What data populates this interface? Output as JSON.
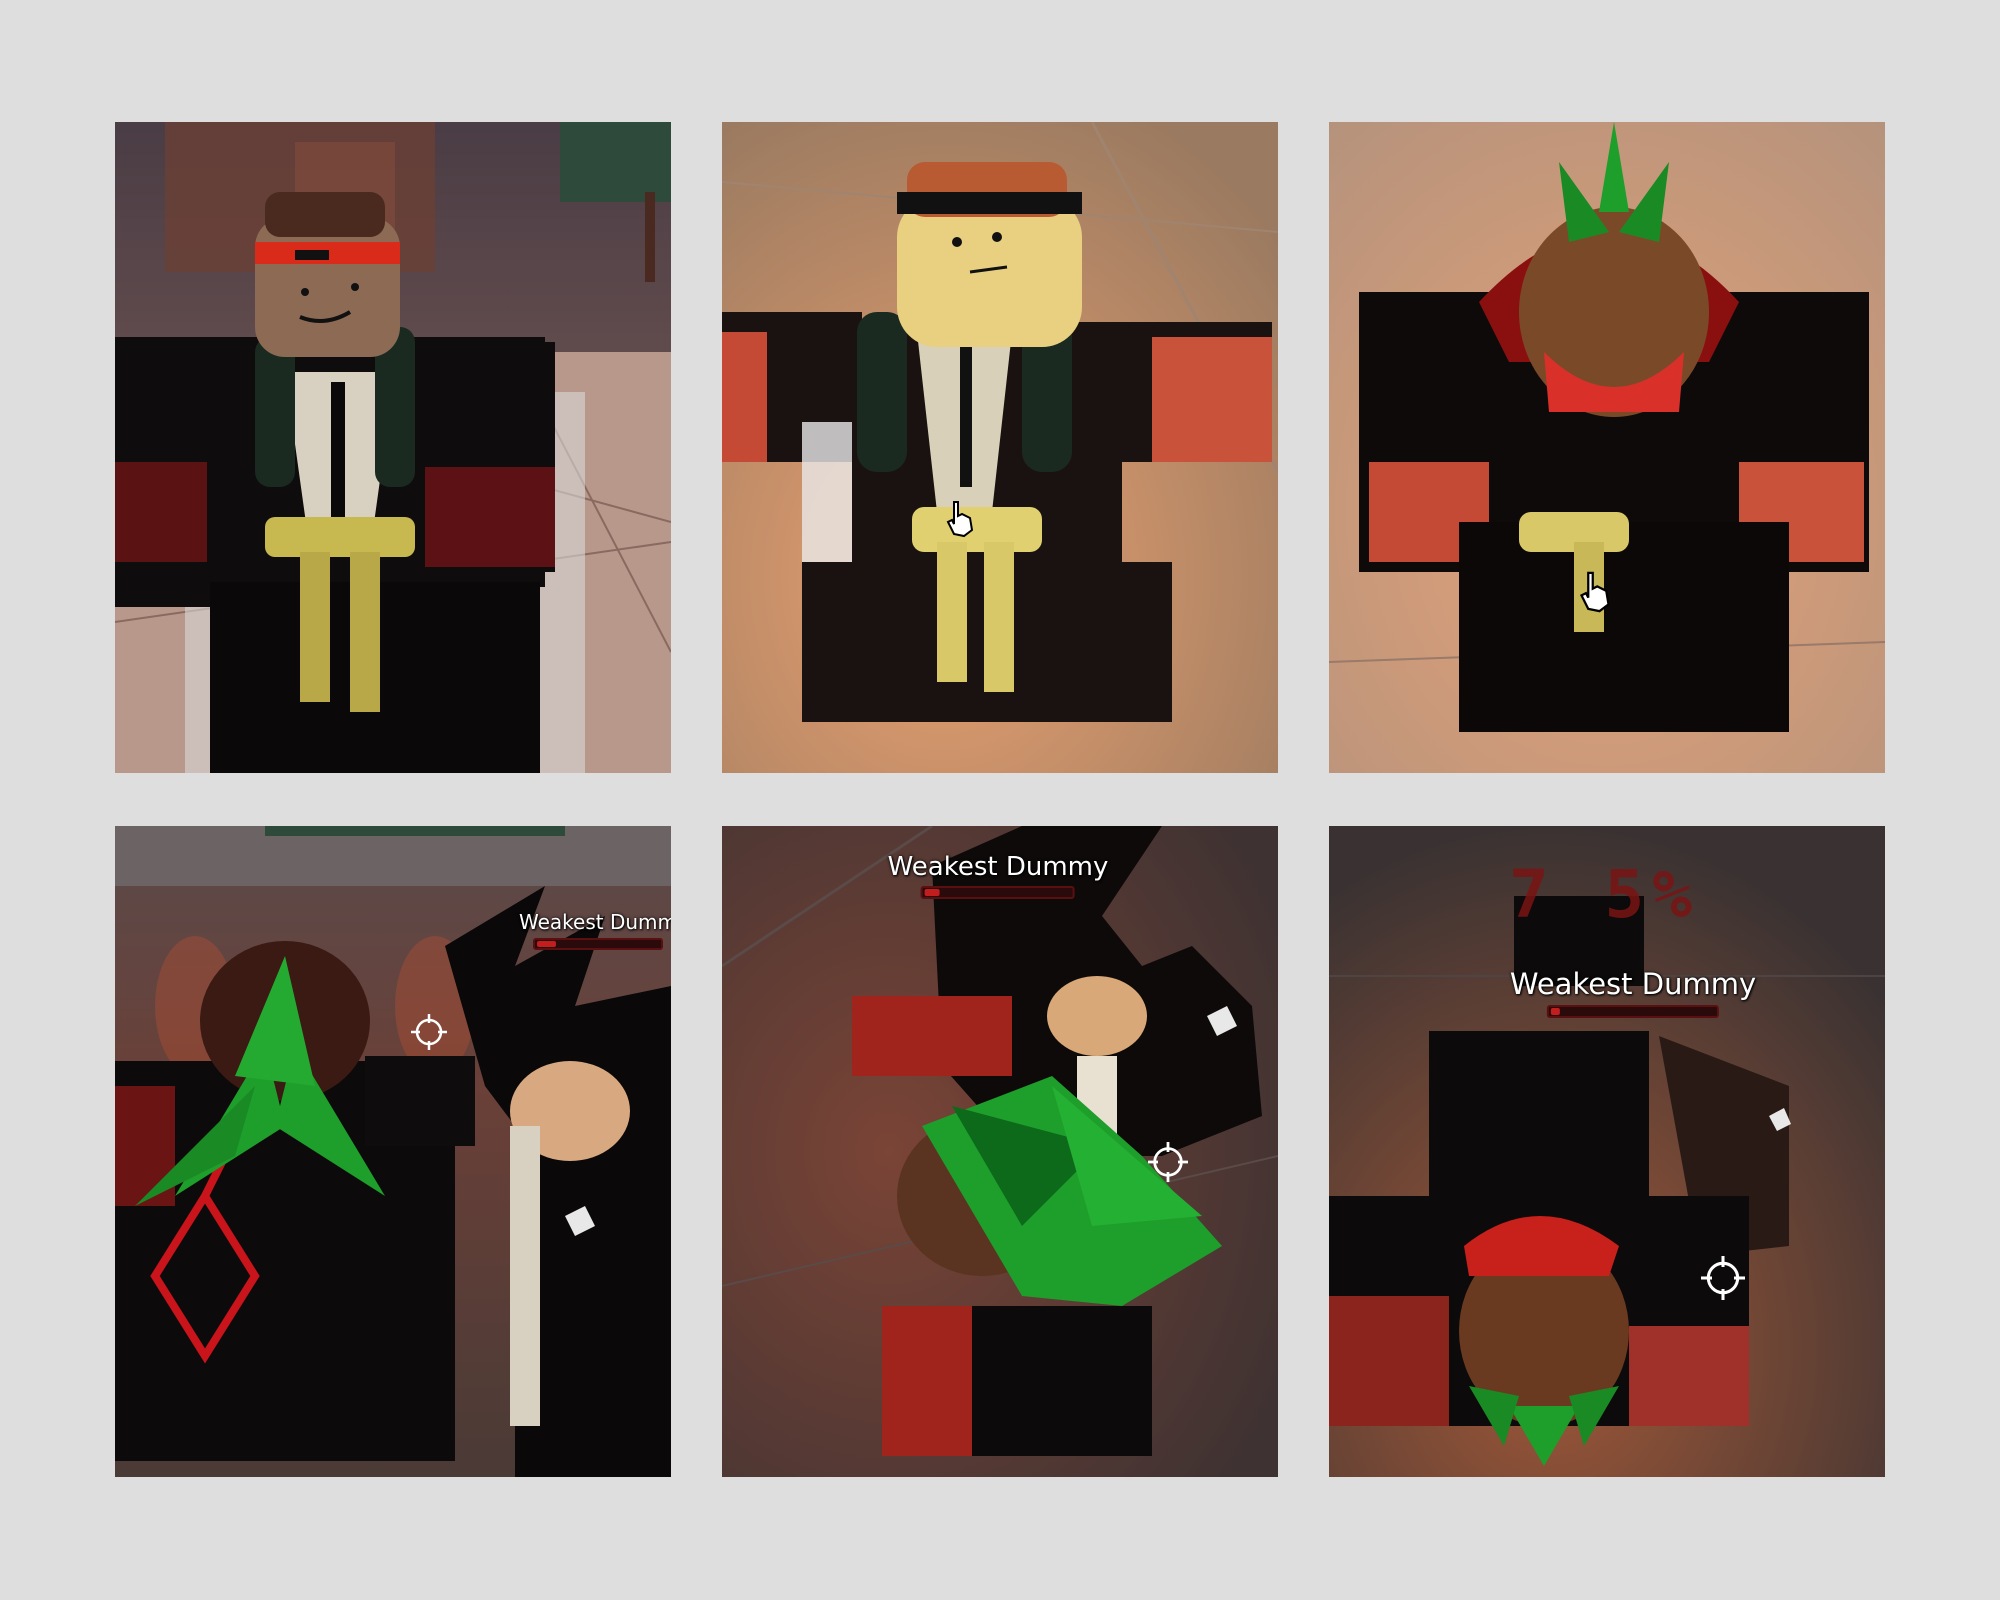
{
  "panels": [
    {
      "id": "p1",
      "description_tag": "avatar-front"
    },
    {
      "id": "p2",
      "description_tag": "avatar-front-closeup"
    },
    {
      "id": "p3",
      "description_tag": "avatar-looking-down"
    },
    {
      "id": "p4",
      "nameplate": {
        "label": "Weakest Dumm",
        "health_fraction": 0.15
      }
    },
    {
      "id": "p5",
      "nameplate": {
        "label": "Weakest Dummy",
        "health_fraction": 0.1
      }
    },
    {
      "id": "p6",
      "nameplate": {
        "label": "Weakest Dummy",
        "health_fraction": 0.05
      },
      "hit_percent": "7 5%"
    }
  ],
  "colors": {
    "background": "#dedede",
    "health_fill": "#c21e1e",
    "accent_red": "#c9402c",
    "foliage_green": "#1e9e2a"
  },
  "icons": [
    "hand-pointer-icon",
    "crosshair-icon"
  ]
}
